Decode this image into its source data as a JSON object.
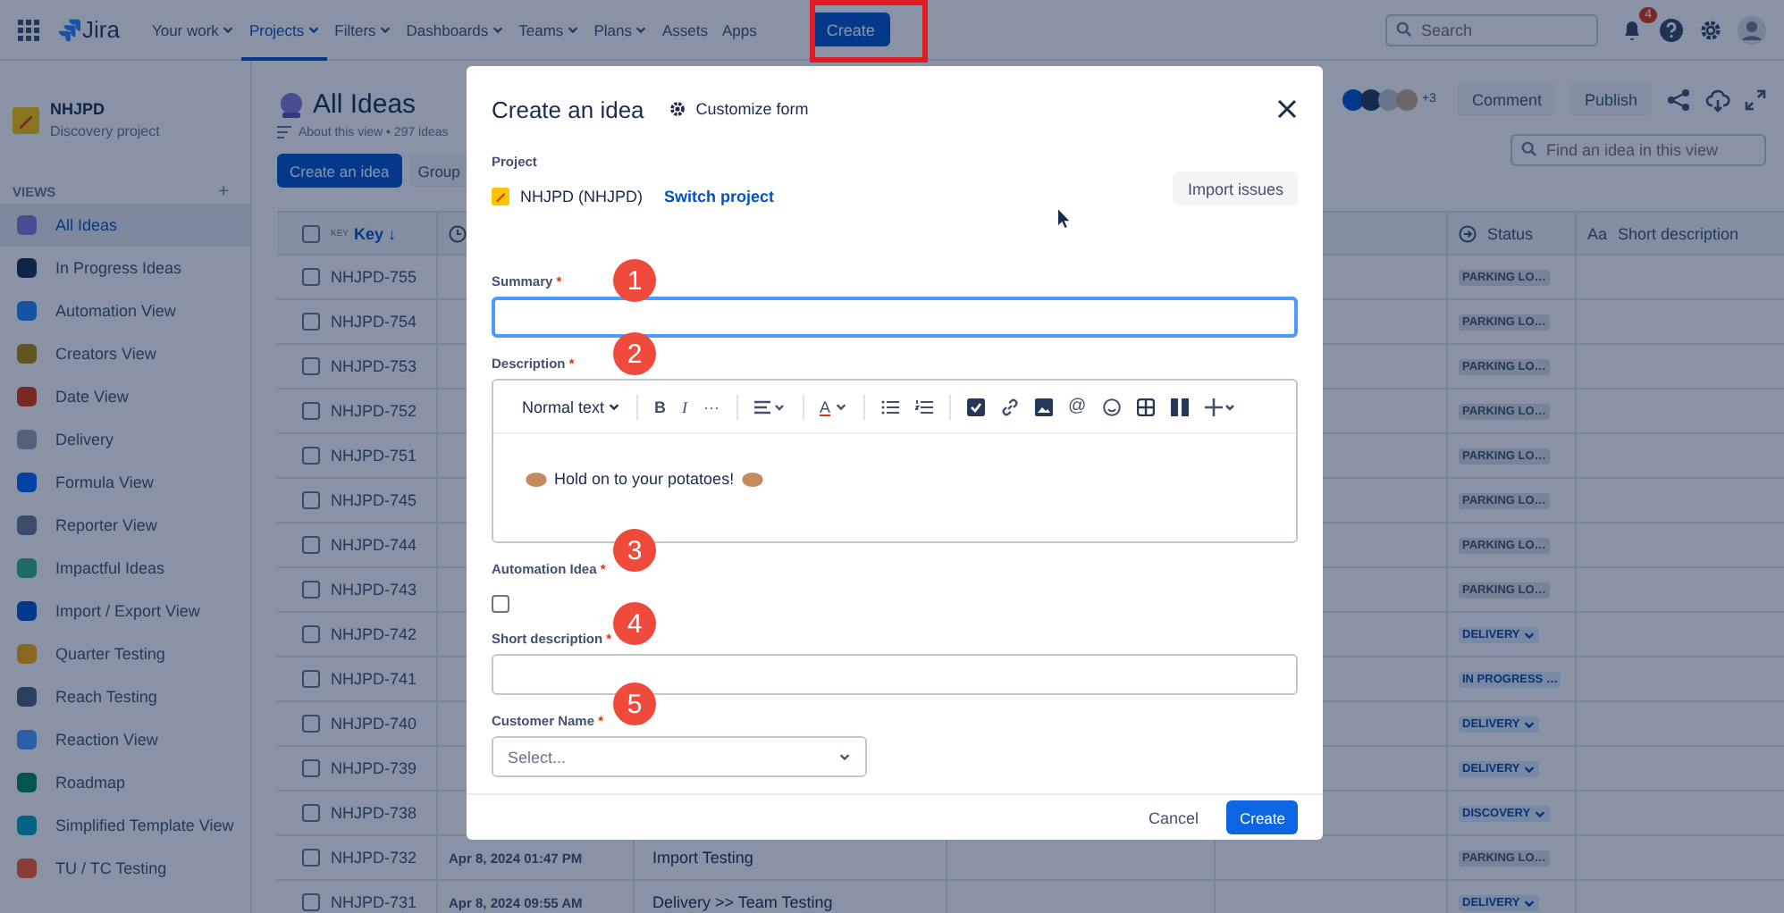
{
  "nav": {
    "logo": "Jira",
    "items": [
      {
        "label": "Your work",
        "caret": true,
        "selected": false
      },
      {
        "label": "Projects",
        "caret": true,
        "selected": true
      },
      {
        "label": "Filters",
        "caret": true,
        "selected": false
      },
      {
        "label": "Dashboards",
        "caret": true,
        "selected": false
      },
      {
        "label": "Teams",
        "caret": true,
        "selected": false
      },
      {
        "label": "Plans",
        "caret": true,
        "selected": false
      },
      {
        "label": "Assets",
        "caret": false,
        "selected": false
      },
      {
        "label": "Apps",
        "caret": false,
        "selected": false
      }
    ],
    "create": "Create",
    "search": {
      "placeholder": "Search"
    },
    "notifications": "4"
  },
  "sidebar": {
    "project": "NHJPD",
    "project_type": "Discovery project",
    "section": "VIEWS",
    "add": "+",
    "items": [
      {
        "label": "All Ideas",
        "selected": true
      },
      {
        "label": "In Progress Ideas",
        "selected": false
      },
      {
        "label": "Automation View",
        "selected": false
      },
      {
        "label": "Creators View",
        "selected": false
      },
      {
        "label": "Date View",
        "selected": false
      },
      {
        "label": "Delivery",
        "selected": false
      },
      {
        "label": "Formula View",
        "selected": false
      },
      {
        "label": "Reporter View",
        "selected": false
      },
      {
        "label": "Impactful Ideas",
        "selected": false
      },
      {
        "label": "Import / Export View",
        "selected": false
      },
      {
        "label": "Quarter Testing",
        "selected": false
      },
      {
        "label": "Reach Testing",
        "selected": false
      },
      {
        "label": "Reaction View",
        "selected": false
      },
      {
        "label": "Roadmap",
        "selected": false
      },
      {
        "label": "Simplified Template View",
        "selected": false
      },
      {
        "label": "TU / TC Testing",
        "selected": false
      }
    ]
  },
  "view": {
    "title": "All Ideas",
    "meta": "About this view • 297 ideas",
    "create_button": "Create an idea",
    "group_button": "Group",
    "more_people": "+3",
    "comment": "Comment",
    "publish": "Publish",
    "search": {
      "placeholder": "Find an idea in this view"
    }
  },
  "table": {
    "header_checked": false,
    "key_tag": "KEY",
    "key_header": "Key ↓",
    "status_header": "Status",
    "short_prefix": "Aa",
    "short_header": "Short description",
    "rows": [
      {
        "key": "NHJPD-755",
        "status": "PARKING LO…",
        "kind": "neutral",
        "caret": false,
        "checked": false
      },
      {
        "key": "NHJPD-754",
        "status": "PARKING LO…",
        "kind": "neutral",
        "caret": false,
        "checked": false
      },
      {
        "key": "NHJPD-753",
        "status": "PARKING LO…",
        "kind": "neutral",
        "caret": false,
        "checked": false
      },
      {
        "key": "NHJPD-752",
        "status": "PARKING LO…",
        "kind": "neutral",
        "caret": false,
        "checked": false
      },
      {
        "key": "NHJPD-751",
        "status": "PARKING LO…",
        "kind": "neutral",
        "caret": false,
        "checked": false
      },
      {
        "key": "NHJPD-745",
        "status": "PARKING LO…",
        "kind": "neutral",
        "caret": false,
        "checked": false
      },
      {
        "key": "NHJPD-744",
        "status": "PARKING LO…",
        "kind": "neutral",
        "caret": false,
        "checked": false
      },
      {
        "key": "NHJPD-743",
        "status": "PARKING LO…",
        "kind": "neutral",
        "caret": false,
        "checked": false
      },
      {
        "key": "NHJPD-742",
        "status": "DELIVERY",
        "kind": "blue",
        "caret": true,
        "checked": false
      },
      {
        "key": "NHJPD-741",
        "status": "IN PROGRESS …",
        "kind": "blue",
        "caret": false,
        "checked": false
      },
      {
        "key": "NHJPD-740",
        "status": "DELIVERY",
        "kind": "blue",
        "caret": true,
        "checked": false
      },
      {
        "key": "NHJPD-739",
        "status": "DELIVERY",
        "kind": "blue",
        "caret": true,
        "checked": false
      },
      {
        "key": "NHJPD-738",
        "status": "DISCOVERY",
        "kind": "blue",
        "caret": true,
        "checked": false
      },
      {
        "key": "NHJPD-732",
        "created": "Apr 8, 2024 01:47 PM",
        "title": "Import Testing",
        "status": "PARKING LO…",
        "kind": "neutral",
        "caret": false,
        "checked": false
      },
      {
        "key": "NHJPD-731",
        "created": "Apr 8, 2024 09:55 AM",
        "title": "Delivery >> Team Testing",
        "status": "DELIVERY",
        "kind": "blue",
        "caret": true,
        "checked": false
      }
    ]
  },
  "dialog": {
    "title": "Create an idea",
    "customize": "Customize form",
    "project_label": "Project",
    "import": "Import issues",
    "project": "NHJPD (NHJPD)",
    "switch": "Switch project",
    "summary": {
      "label": "Summary",
      "required": "*",
      "focused": true
    },
    "description": {
      "label": "Description",
      "required": "*",
      "format": "Normal text",
      "bold": "B",
      "italic": "I",
      "more": "···",
      "font_color_button": "A",
      "mention": "@",
      "text": "Hold on to your potatoes!"
    },
    "automation": {
      "label": "Automation Idea",
      "required": "*",
      "checked": false
    },
    "short_description": {
      "label": "Short description",
      "required": "*"
    },
    "customer": {
      "label": "Customer Name",
      "required": "*",
      "placeholder": "Select..."
    },
    "cancel": "Cancel",
    "create": "Create"
  },
  "annotations": [
    "1",
    "2",
    "3",
    "4",
    "5"
  ]
}
